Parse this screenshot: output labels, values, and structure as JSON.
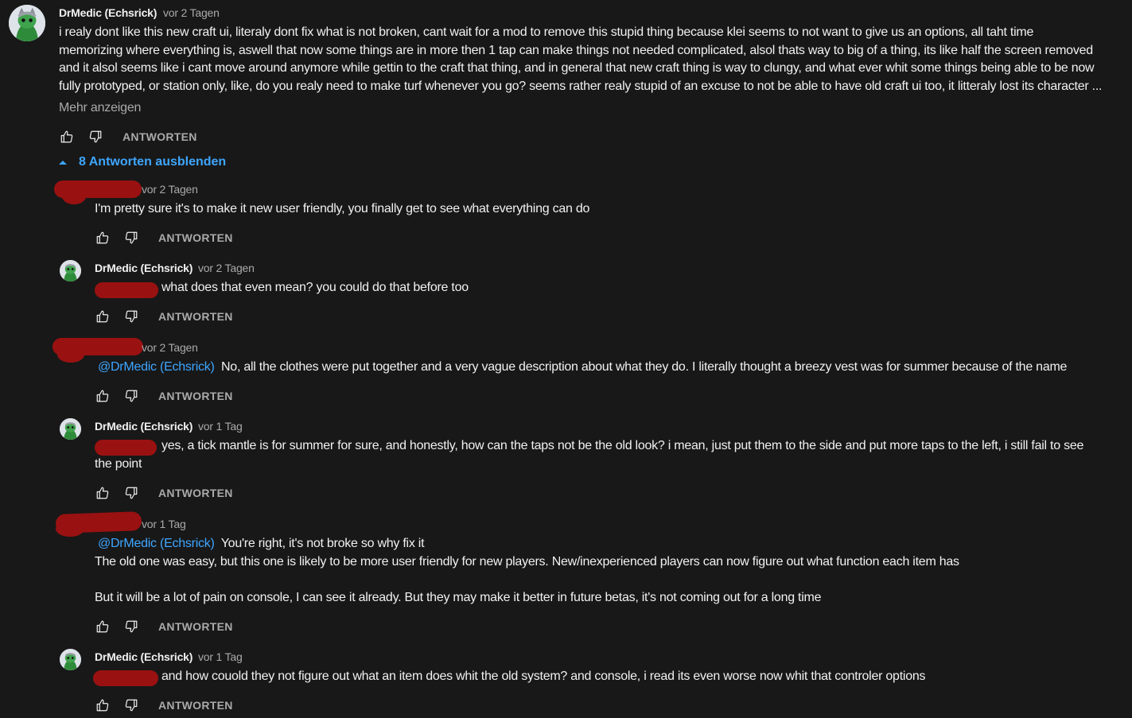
{
  "colors": {
    "background": "#181818",
    "text": "#f1f1f1",
    "muted": "#aaaaaa",
    "link": "#3ea6ff",
    "redaction": "#9a1111"
  },
  "icons": {
    "like": "thumbs-up-icon",
    "dislike": "thumbs-down-icon",
    "collapse": "chevron-up-icon",
    "avatar": "lizard-avatar-icon"
  },
  "main_comment": {
    "author": "DrMedic (Echsrick)",
    "time": "vor 2 Tagen",
    "lines": [
      "i realy dont like this new craft ui, literaly dont fix what is not broken, cant wait for a mod to remove this stupid thing because klei seems to not want to give us an options, all taht time",
      "memorizing where everything is,  aswell that now some things are in more then 1 tap can make things not needed complicated, alsol thats way to big of a thing, its like half the screen removed",
      "and it alsol seems like i cant move around anymore while gettin to the craft that thing, and in general that new craft thing is way to clungy, and what ever whit some things being able to be now",
      "fully prototyped, or station only, like, do you realy need to make turf whenever you go? seems rather realy stupid of an excuse to not be able to have old craft ui too, it litteraly lost its character ..."
    ],
    "show_more": "Mehr anzeigen",
    "reply_label": "ANTWORTEN"
  },
  "replies_toggle": "8 Antworten ausblenden",
  "replies": [
    {
      "author": "",
      "time": "vor 2 Tagen",
      "mention": "",
      "text": "I'm pretty sure it's to make it new user friendly, you finally get to see what everything can do",
      "reply_label": "ANTWORTEN"
    },
    {
      "author": "DrMedic (Echsrick)",
      "time": "vor 2 Tagen",
      "mention": "",
      "text": "what does that even mean? you could do that before too",
      "reply_label": "ANTWORTEN"
    },
    {
      "author": "",
      "time": "vor 2 Tagen",
      "mention": "@DrMedic (Echsrick)",
      "text": "No, all the clothes were put together and a very vague description about what they do. I literally thought a breezy vest was for summer because of the name",
      "reply_label": "ANTWORTEN"
    },
    {
      "author": "DrMedic (Echsrick)",
      "time": "vor 1 Tag",
      "mention": "",
      "text": "yes, a tick mantle is for summer for sure, and honestly, how can the taps not be the old look? i mean, just put them to the side and put more taps to the left, i still fail to see",
      "text2": "the point",
      "reply_label": "ANTWORTEN"
    },
    {
      "author": "",
      "time": "vor 1 Tag",
      "mention": "@DrMedic (Echsrick)",
      "text": "You're right, it's not broke so why fix it",
      "text2": "The old one was easy, but this one is likely to be more user friendly for new players. New/inexperienced players can now figure out what function each item has",
      "text3": "But it will be a lot of pain on console, I can see it already. But they may make it better in future betas, it's not coming out for a long time",
      "reply_label": "ANTWORTEN"
    },
    {
      "author": "DrMedic (Echsrick)",
      "time": "vor 1 Tag",
      "mention": "",
      "text": "and how couold they not figure out what an item does whit the old system? and console, i read its even worse now whit that controler options",
      "reply_label": "ANTWORTEN"
    }
  ]
}
